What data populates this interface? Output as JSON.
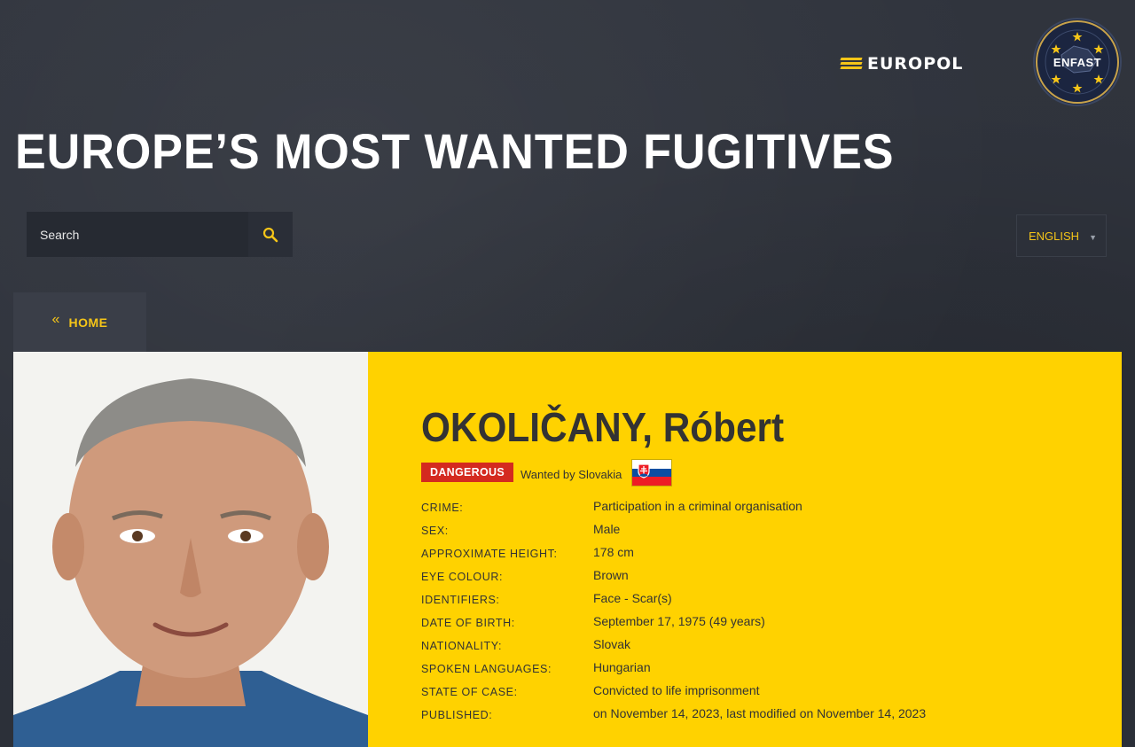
{
  "header": {
    "europol_logo": "EUROPOL",
    "enfast_logo": "ENFAST",
    "title": "EUROPE’S MOST WANTED FUGITIVES"
  },
  "search": {
    "placeholder": "Search",
    "icon": "search-icon"
  },
  "language": {
    "selected": "ENGLISH",
    "icon": "chevron-down-icon"
  },
  "nav": {
    "home_label": "HOME",
    "icon": "double-chevron-left-icon"
  },
  "fugitive": {
    "name": "OKOLIČANY, Róbert",
    "badge": "DANGEROUS",
    "wanted_by": "Wanted by Slovakia",
    "flag": "slovakia-flag",
    "fields": [
      {
        "label": "CRIME:",
        "value": "Participation in a criminal organisation"
      },
      {
        "label": "SEX:",
        "value": "Male"
      },
      {
        "label": "APPROXIMATE HEIGHT:",
        "value": "178 cm"
      },
      {
        "label": "EYE COLOUR:",
        "value": "Brown"
      },
      {
        "label": "IDENTIFIERS:",
        "value": "Face - Scar(s)"
      },
      {
        "label": "DATE OF BIRTH:",
        "value": "September 17, 1975 (49 years)"
      },
      {
        "label": "NATIONALITY:",
        "value": "Slovak"
      },
      {
        "label": "SPOKEN LANGUAGES:",
        "value": "Hungarian"
      },
      {
        "label": "STATE OF CASE:",
        "value": "Convicted to life imprisonment"
      },
      {
        "label": "PUBLISHED:",
        "value": "on November 14, 2023, last modified on November 14, 2023"
      }
    ]
  },
  "colors": {
    "accent": "#ffd200",
    "danger": "#d42a1f",
    "background": "#2f333c",
    "nav_text": "#f5c518"
  }
}
